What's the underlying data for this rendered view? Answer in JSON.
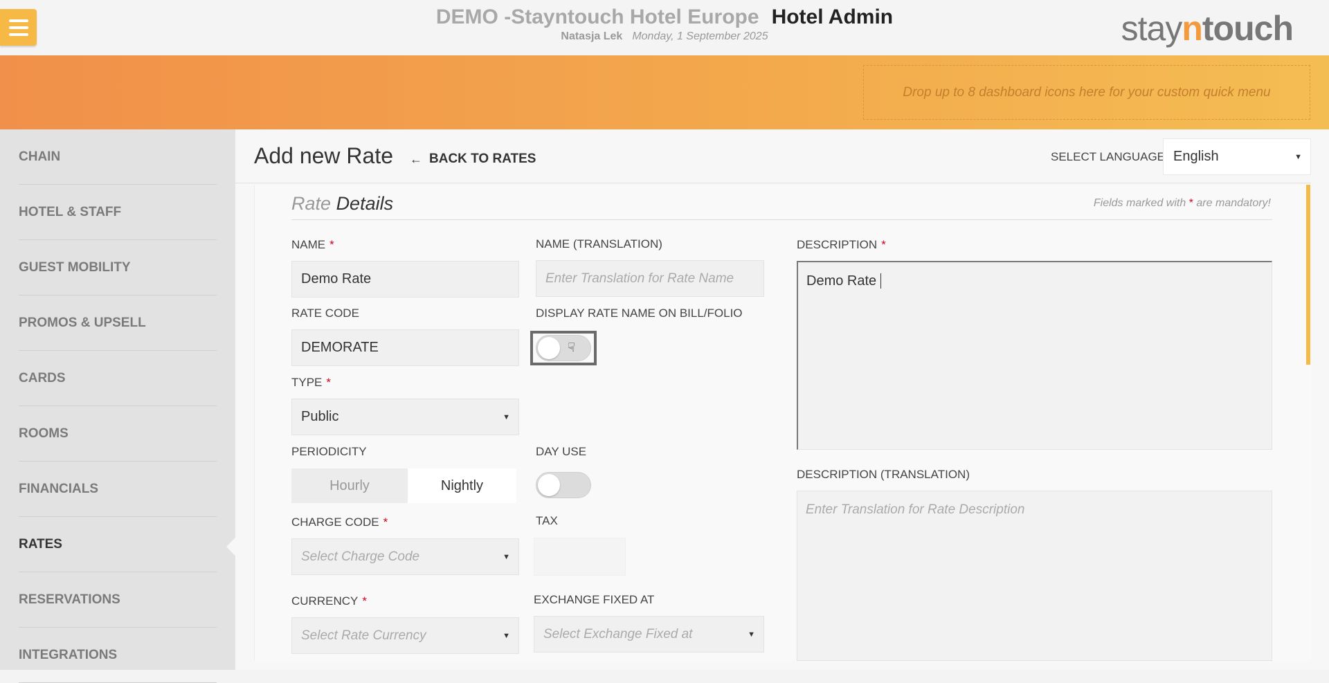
{
  "header": {
    "hotel_name": "DEMO -Stayntouch Hotel Europe",
    "app_title": "Hotel Admin",
    "user": "Natasja Lek",
    "date": "Monday, 1 September 2025",
    "logo_stay": "stay",
    "logo_n": "n",
    "logo_touch": "touch"
  },
  "quickbar": {
    "dropzone_text": "Drop up to 8 dashboard icons here for your custom quick menu"
  },
  "sidebar": {
    "items": [
      {
        "label": "CHAIN"
      },
      {
        "label": "HOTEL & STAFF"
      },
      {
        "label": "GUEST MOBILITY"
      },
      {
        "label": "PROMOS & UPSELL"
      },
      {
        "label": "CARDS"
      },
      {
        "label": "ROOMS"
      },
      {
        "label": "FINANCIALS"
      },
      {
        "label": "RATES"
      },
      {
        "label": "RESERVATIONS"
      },
      {
        "label": "INTEGRATIONS"
      }
    ],
    "active": "RATES"
  },
  "page": {
    "title": "Add new Rate",
    "back_label": "BACK TO RATES",
    "select_language_label": "SELECT LANGUAGE",
    "language_value": "English"
  },
  "form": {
    "section_light": "Rate",
    "section_bold": "Details",
    "mandatory_prefix": "Fields marked with",
    "mandatory_star": "*",
    "mandatory_suffix": "are mandatory!",
    "name_label": "NAME",
    "name_value": "Demo Rate",
    "name_translation_label": "NAME (TRANSLATION)",
    "name_translation_placeholder": "Enter Translation for Rate Name",
    "rate_code_label": "RATE CODE",
    "rate_code_value": "DEMORATE",
    "display_name_label": "DISPLAY RATE NAME ON BILL/FOLIO",
    "type_label": "TYPE",
    "type_value": "Public",
    "periodicity_label": "PERIODICITY",
    "periodicity_options": [
      "Hourly",
      "Nightly"
    ],
    "periodicity_selected": "Nightly",
    "day_use_label": "DAY USE",
    "charge_code_label": "CHARGE CODE",
    "charge_code_placeholder": "Select Charge Code",
    "tax_label": "TAX",
    "currency_label": "CURRENCY",
    "currency_placeholder": "Select Rate Currency",
    "exchange_label": "EXCHANGE FIXED AT",
    "exchange_placeholder": "Select Exchange Fixed at",
    "description_label": "DESCRIPTION",
    "description_value": "Demo Rate",
    "description_translation_label": "DESCRIPTION (TRANSLATION)",
    "description_translation_placeholder": "Enter Translation for Rate Description",
    "required_star": "*"
  },
  "colors": {
    "accent_yellow": "#f6b946",
    "orange_start": "#f1904a",
    "orange_end": "#f4bd53",
    "required_red": "#d0021b"
  }
}
